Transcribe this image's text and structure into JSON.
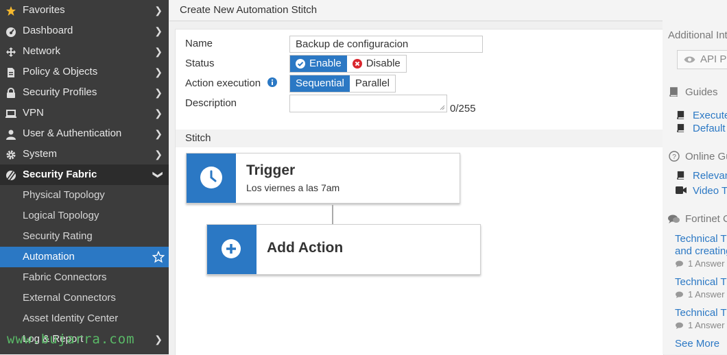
{
  "sidebar": {
    "items": [
      {
        "label": "Favorites",
        "icon": "star-icon"
      },
      {
        "label": "Dashboard",
        "icon": "dashboard-icon"
      },
      {
        "label": "Network",
        "icon": "network-icon"
      },
      {
        "label": "Policy & Objects",
        "icon": "document-icon"
      },
      {
        "label": "Security Profiles",
        "icon": "lock-icon"
      },
      {
        "label": "VPN",
        "icon": "laptop-icon"
      },
      {
        "label": "User & Authentication",
        "icon": "user-icon"
      },
      {
        "label": "System",
        "icon": "gear-icon"
      },
      {
        "label": "Security Fabric",
        "icon": "fabric-icon",
        "expanded": true
      }
    ],
    "sub_items": [
      {
        "label": "Physical Topology"
      },
      {
        "label": "Logical Topology"
      },
      {
        "label": "Security Rating"
      },
      {
        "label": "Automation",
        "active": true
      },
      {
        "label": "Fabric Connectors"
      },
      {
        "label": "External Connectors"
      },
      {
        "label": "Asset Identity Center"
      }
    ],
    "log_report": {
      "label": "Log & Report"
    },
    "watermark": "www.bujarra.com"
  },
  "header": {
    "title": "Create New Automation Stitch"
  },
  "form": {
    "name_label": "Name",
    "name_value": "Backup de configuracion",
    "status_label": "Status",
    "status_enable": "Enable",
    "status_disable": "Disable",
    "action_execution_label": "Action execution",
    "exec_sequential": "Sequential",
    "exec_parallel": "Parallel",
    "description_label": "Description",
    "description_value": "",
    "description_count": "0/255"
  },
  "stitch": {
    "section_label": "Stitch",
    "trigger_title": "Trigger",
    "trigger_subtitle": "Los viernes a las 7am",
    "add_action_label": "Add Action"
  },
  "right_panel": {
    "additional_info": "Additional Int",
    "api_preview": "API Pr",
    "guides_title": "Guides",
    "guide_links": [
      "Execute",
      "Default"
    ],
    "online_guides_title": "Online Gu",
    "online_links": [
      "Relevan",
      "Video T"
    ],
    "community_title": "Fortinet C",
    "community_posts": [
      {
        "title_line1": "Technical Ti",
        "title_line2": "and creating",
        "answers": "1 Answer"
      },
      {
        "title_line1": "Technical Ti",
        "title_line2": "",
        "answers": "1 Answer"
      },
      {
        "title_line1": "Technical Ti",
        "title_line2": "",
        "answers": "1 Answer"
      }
    ],
    "see_more": "See More"
  },
  "colors": {
    "accent": "#2b78c4",
    "sidebar_bg": "#3c3c3c",
    "watermark": "#5cc06a"
  }
}
